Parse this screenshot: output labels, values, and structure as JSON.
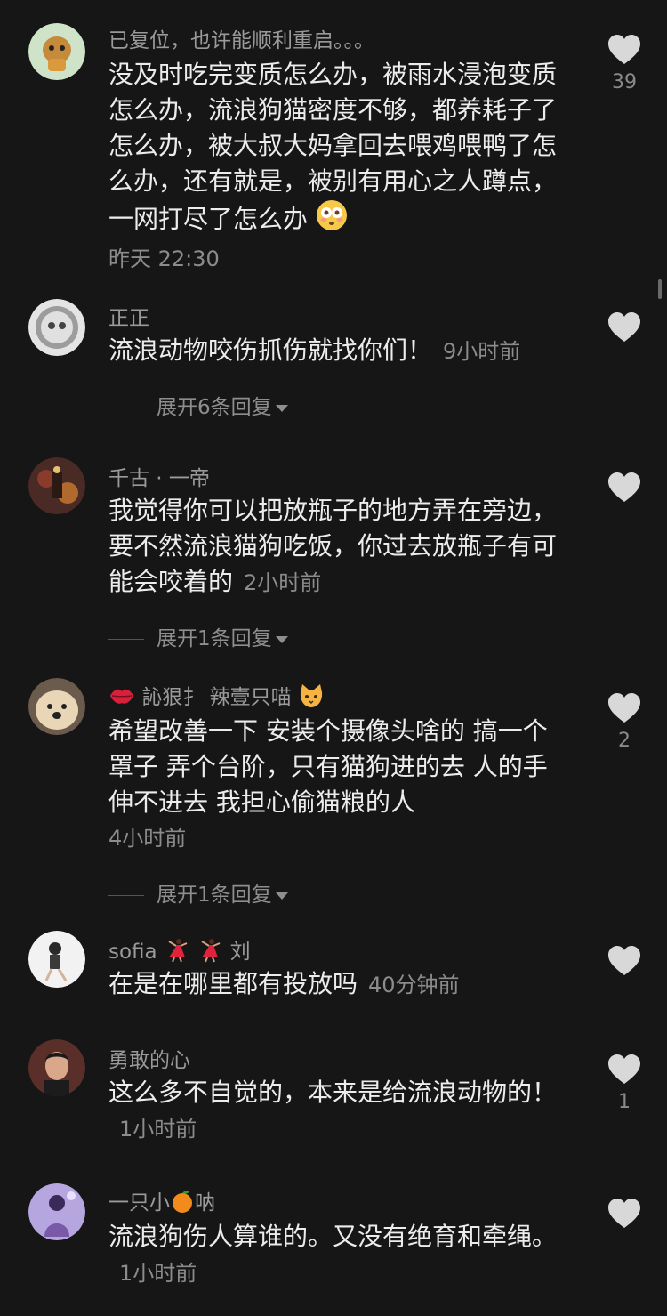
{
  "comments": [
    {
      "name": "已复位，也许能顺利重启。。。",
      "text": "没及时吃完变质怎么办，被雨水浸泡变质怎么办，流浪狗猫密度不够，都养耗子了怎么办，被大叔大妈拿回去喂鸡喂鸭了怎么办，还有就是，被别有用心之人蹲点，一网打尽了怎么办",
      "time": "昨天 22:30",
      "likes": "39",
      "emoji": "flushed-face-emoji"
    },
    {
      "name": "正正",
      "text": "流浪动物咬伤抓伤就找你们！",
      "time": "9小时前",
      "likes": "",
      "replies": "展开6条回复"
    },
    {
      "name": "千古 · 一帝",
      "text": "我觉得你可以把放瓶子的地方弄在旁边，要不然流浪猫狗吃饭，你过去放瓶子有可能会咬着的",
      "time": "2小时前",
      "likes": "",
      "replies": "展开1条回复"
    },
    {
      "name_prefix_emoji": "lips-emoji",
      "name": "訫狠扌 辣壹只喵",
      "name_suffix_emoji": "cat-face-emoji",
      "text": "希望改善一下 安装个摄像头啥的 搞一个罩子 弄个台阶，只有猫狗进的去 人的手伸不进去 我担心偷猫粮的人",
      "time": "4小时前",
      "likes": "2",
      "replies": "展开1条回复"
    },
    {
      "name_a": "sofia",
      "name_emoji": "dancer-emoji",
      "name_b": "刘",
      "text": "在是在哪里都有投放吗",
      "time": "40分钟前",
      "likes": ""
    },
    {
      "name": "勇敢的心",
      "text": "这么多不自觉的，本来是给流浪动物的！",
      "time": "1小时前",
      "likes": "1"
    },
    {
      "name_a": "一只小",
      "name_emoji": "tangerine-emoji",
      "name_b": "呐",
      "text": "流浪狗伤人算谁的。又没有绝育和牵绳。",
      "time": "1小时前",
      "likes": ""
    }
  ],
  "colors": {
    "background": "#161616",
    "text": "#ececec",
    "muted": "#8c8c8c",
    "heart": "#d8d8d8"
  }
}
